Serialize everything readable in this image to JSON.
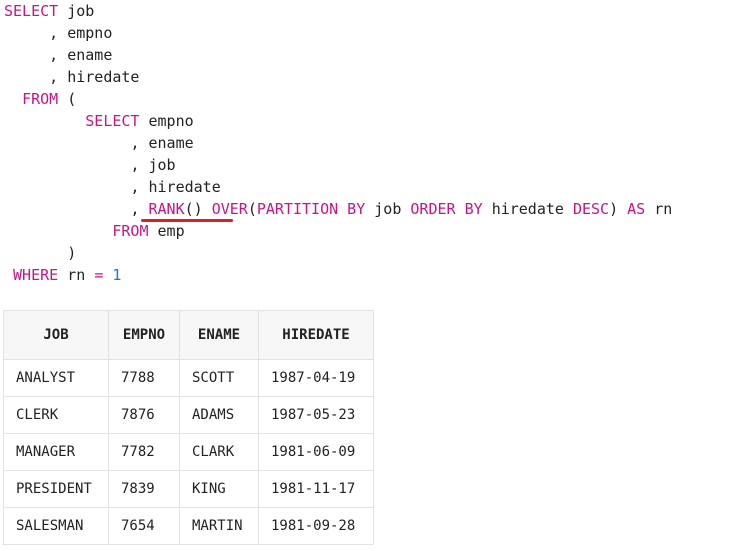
{
  "query": {
    "select_kw": "SELECT",
    "col1": "job",
    "col2": "empno",
    "col3": "ename",
    "col4": "hiredate",
    "from_kw": "FROM",
    "open_paren": "(",
    "sub_select_kw": "SELECT",
    "sub_col1": "empno",
    "sub_col2": "ename",
    "sub_col3": "job",
    "sub_col4": "hiredate",
    "rank_kw": "RANK",
    "rank_parens": "()",
    "over_kw": "OVER",
    "partition_open": "(",
    "partition_kw": "PARTITION BY",
    "partition_col": "job",
    "order_kw": "ORDER BY",
    "order_col": "hiredate",
    "desc_kw": "DESC",
    "partition_close": ")",
    "as_kw": "AS",
    "alias": "rn",
    "sub_from_kw": "FROM",
    "sub_table": "emp",
    "close_paren": ")",
    "where_kw": "WHERE",
    "where_col": "rn",
    "where_op": "=",
    "where_val": "1",
    "comma": ","
  },
  "result": {
    "headers": [
      "JOB",
      "EMPNO",
      "ENAME",
      "HIREDATE"
    ],
    "rows": [
      [
        "ANALYST",
        "7788",
        "SCOTT",
        "1987-04-19"
      ],
      [
        "CLERK",
        "7876",
        "ADAMS",
        "1987-05-23"
      ],
      [
        "MANAGER",
        "7782",
        "CLARK",
        "1981-06-09"
      ],
      [
        "PRESIDENT",
        "7839",
        "KING",
        "1981-11-17"
      ],
      [
        "SALESMAN",
        "7654",
        "MARTIN",
        "1981-09-28"
      ]
    ]
  },
  "colors": {
    "keyword": "#c71585",
    "number": "#1a73e8",
    "highlight_underline": "#e02020"
  }
}
